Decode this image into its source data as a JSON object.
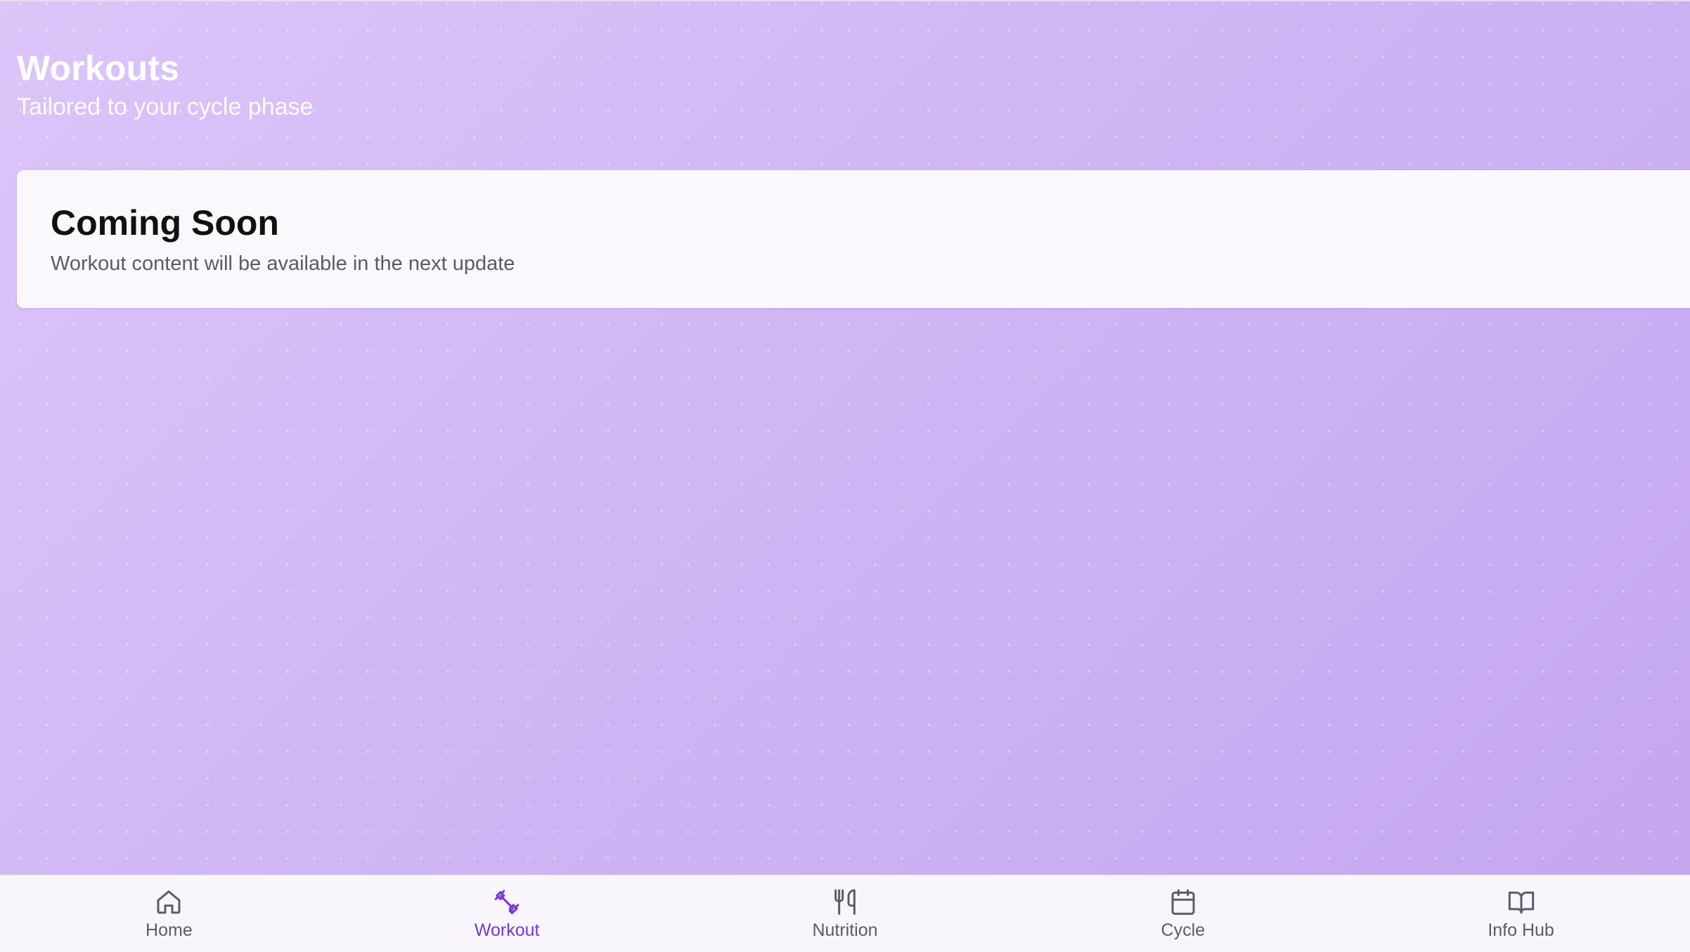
{
  "header": {
    "title": "Workouts",
    "subtitle": "Tailored to your cycle phase"
  },
  "card": {
    "title": "Coming Soon",
    "text": "Workout content will be available in the next update"
  },
  "nav": {
    "items": [
      {
        "label": "Home",
        "icon": "home-icon",
        "active": false
      },
      {
        "label": "Workout",
        "icon": "dumbbell-icon",
        "active": true
      },
      {
        "label": "Nutrition",
        "icon": "utensils-icon",
        "active": false
      },
      {
        "label": "Cycle",
        "icon": "calendar-icon",
        "active": false
      },
      {
        "label": "Info Hub",
        "icon": "book-icon",
        "active": false
      }
    ]
  },
  "colors": {
    "background_start": "#dcc5f9",
    "background_end": "#c4a6f0",
    "accent": "#7a35d8",
    "nav_inactive": "#5c5c66",
    "card_background": "#faf8fd"
  }
}
